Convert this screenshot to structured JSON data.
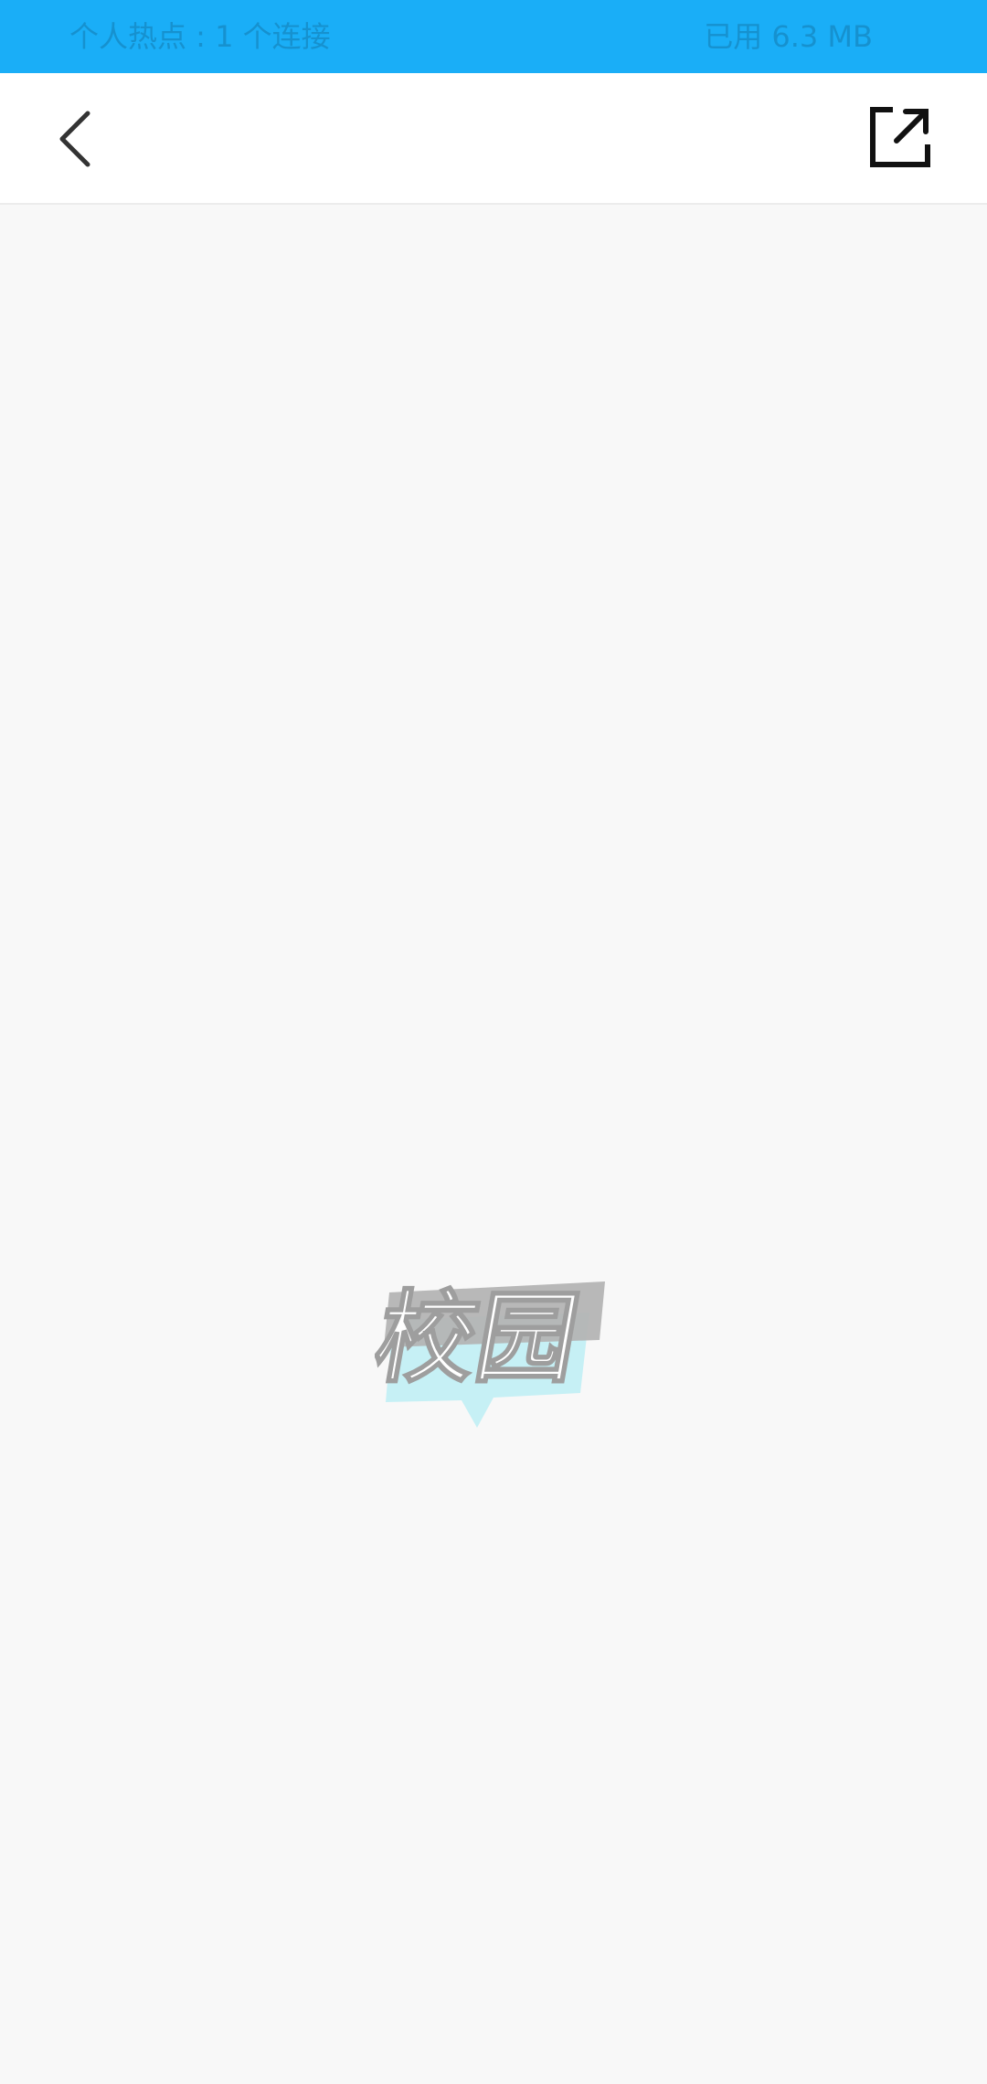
{
  "status_bar": {
    "hotspot_text": "个人热点 : 1 个连接",
    "data_used": "已用 6.3 MB",
    "background_color": "#1aaef7",
    "text_color": "#1691cf"
  },
  "nav": {
    "back_icon": "chevron-left-icon",
    "share_icon": "share-external-icon"
  },
  "loading": {
    "logo_text": "校园",
    "logo_gray": "#b4b4b4",
    "logo_cyan": "#bdeef5"
  }
}
